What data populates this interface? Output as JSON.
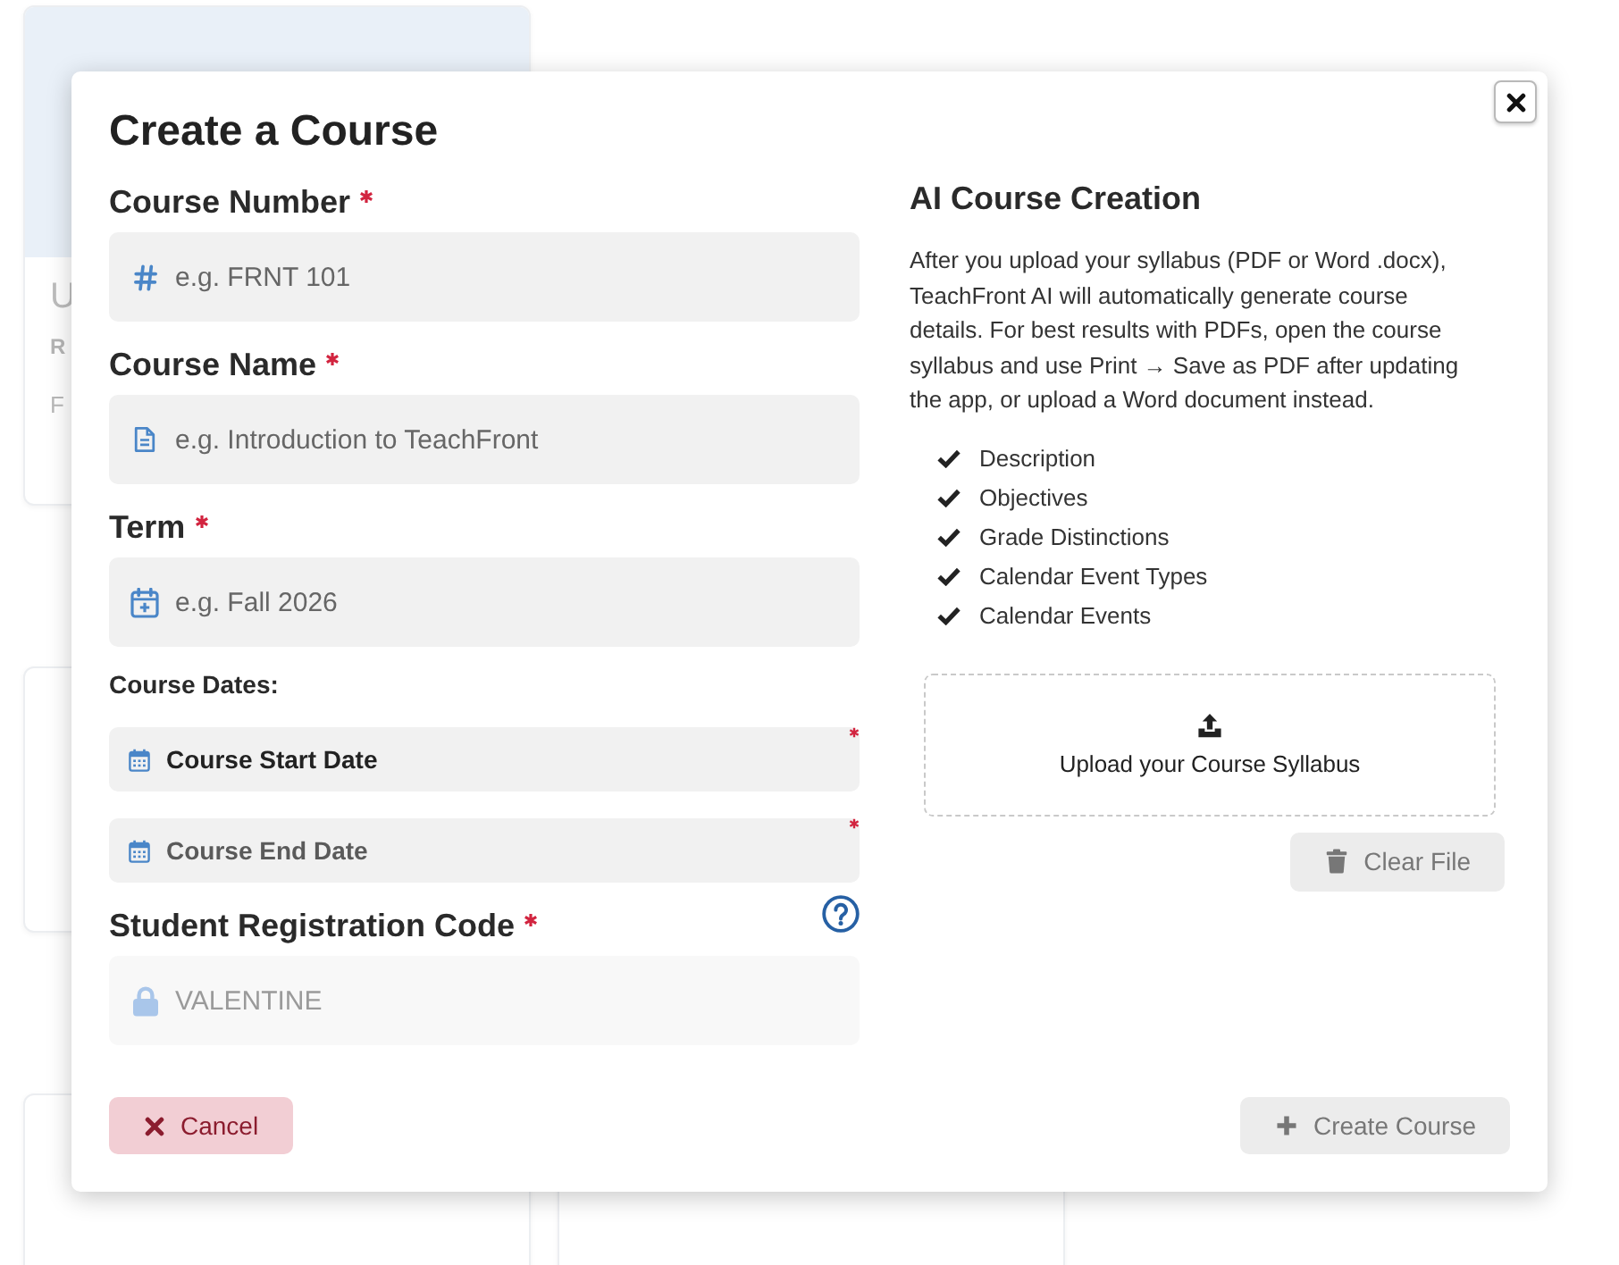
{
  "background_card": {
    "texts": [
      {
        "kind": "title",
        "text": "U"
      },
      {
        "kind": "code",
        "text": "R"
      },
      {
        "kind": "detail",
        "text": "F"
      }
    ]
  },
  "dialog": {
    "title": "Create a Course",
    "fields": [
      {
        "kind": "input",
        "label": "Course Number",
        "required": true,
        "placeholder": "e.g. FRNT 101"
      },
      {
        "kind": "input",
        "label": "Course Name",
        "required": true,
        "placeholder": "e.g. Introduction to TeachFront"
      },
      {
        "kind": "input",
        "label": "Term",
        "required": true,
        "placeholder": "e.g. Fall 2026"
      },
      {
        "kind": "section",
        "label": "Course Dates:"
      },
      {
        "kind": "date",
        "placeholder": "Course Start Date",
        "required": true,
        "active": true
      },
      {
        "kind": "date",
        "placeholder": "Course End Date",
        "required": true,
        "active": false
      },
      {
        "kind": "input",
        "label": "Student Registration Code",
        "required": true,
        "help": true,
        "value": "VALENTINE",
        "disabled": true
      }
    ],
    "ai_panel": {
      "title": "AI Course Creation",
      "description": "After you upload your syllabus (PDF or Word .docx), TeachFront AI will automatically generate course details. For best results with PDFs, open the course syllabus and use Print → Save as PDF after updating the app, or upload a Word document instead.",
      "features": [
        {
          "label": "Description",
          "checked": true
        },
        {
          "label": "Objectives",
          "checked": true
        },
        {
          "label": "Grade Distinctions",
          "checked": true
        },
        {
          "label": "Calendar Event Types",
          "checked": true
        },
        {
          "label": "Calendar Events",
          "checked": true
        }
      ],
      "upload": {
        "label": "Upload your Course Syllabus"
      },
      "clear_button": {
        "kind": "clear",
        "label": "Clear File",
        "disabled": true
      }
    },
    "buttons": [
      {
        "kind": "cancel",
        "label": "Cancel",
        "disabled": false
      },
      {
        "kind": "create",
        "label": "Create Course",
        "disabled": true
      }
    ]
  }
}
